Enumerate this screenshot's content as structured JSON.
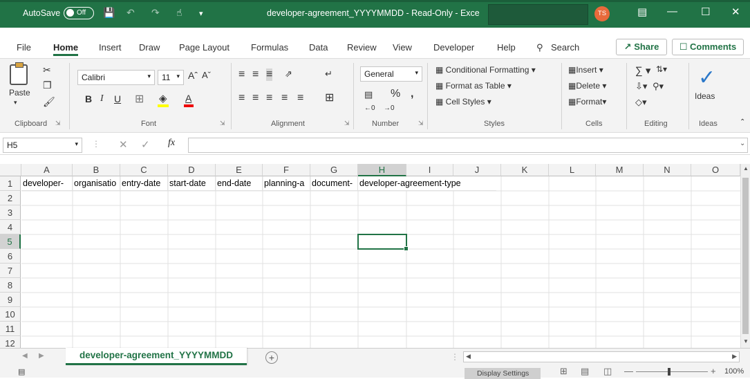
{
  "titlebar": {
    "autosave_label": "AutoSave",
    "autosave_state": "Off",
    "doc_title": "developer-agreement_YYYYMMDD  -  Read-Only  -  Exce",
    "user_initials": "TS"
  },
  "ribbon_tabs": [
    "File",
    "Home",
    "Insert",
    "Draw",
    "Page Layout",
    "Formulas",
    "Data",
    "Review",
    "View",
    "Developer",
    "Help"
  ],
  "search_label": "Search",
  "share_label": "Share",
  "comments_label": "Comments",
  "ribbon": {
    "paste_label": "Paste",
    "font_name": "Calibri",
    "font_size": "11",
    "number_format": "General",
    "conditional_formatting": "Conditional Formatting",
    "format_as_table": "Format as Table",
    "cell_styles": "Cell Styles",
    "insert": "Insert",
    "delete": "Delete",
    "format": "Format",
    "ideas": "Ideas",
    "groups": [
      "Clipboard",
      "Font",
      "Alignment",
      "Number",
      "Styles",
      "Cells",
      "Editing",
      "Ideas"
    ]
  },
  "formula_bar": {
    "name_box": "H5",
    "formula": ""
  },
  "columns": [
    "A",
    "B",
    "C",
    "D",
    "E",
    "F",
    "G",
    "H",
    "I",
    "J",
    "K",
    "L",
    "M",
    "N",
    "O"
  ],
  "rows": [
    "1",
    "2",
    "3",
    "4",
    "5",
    "6",
    "7",
    "8",
    "9",
    "10",
    "11",
    "12"
  ],
  "row1_cells": [
    "developer-",
    "organisatio",
    "entry-date",
    "start-date",
    "end-date",
    "planning-a",
    "document-",
    "developer-agreement-type"
  ],
  "active_cell": "H5",
  "sheet": {
    "tab_name": "developer-agreement_YYYYMMDD"
  },
  "status": {
    "display_settings": "Display Settings",
    "zoom": "100%"
  }
}
